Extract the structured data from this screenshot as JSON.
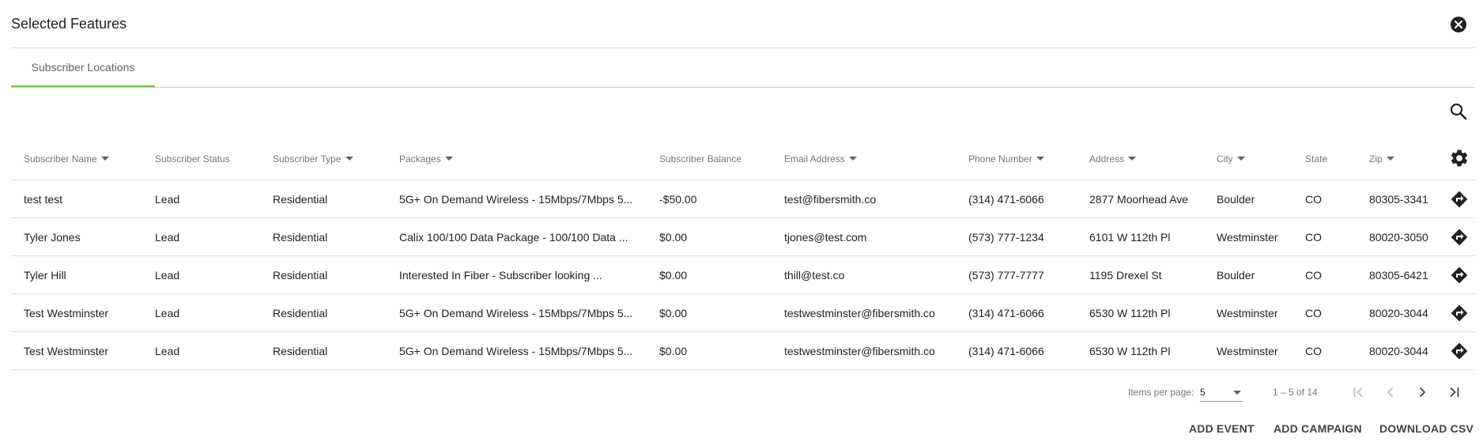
{
  "header": {
    "title": "Selected Features"
  },
  "tabs": [
    {
      "label": "Subscriber Locations"
    }
  ],
  "table": {
    "columns": [
      {
        "label": "Subscriber Name"
      },
      {
        "label": "Subscriber Status"
      },
      {
        "label": "Subscriber Type"
      },
      {
        "label": "Packages"
      },
      {
        "label": "Subscriber Balance"
      },
      {
        "label": "Email Address"
      },
      {
        "label": "Phone Number"
      },
      {
        "label": "Address"
      },
      {
        "label": "City"
      },
      {
        "label": "State"
      },
      {
        "label": "Zip"
      }
    ],
    "rows": [
      {
        "name": "test test",
        "status": "Lead",
        "type": "Residential",
        "packages": "5G+ On Demand Wireless - 15Mbps/7Mbps 5...",
        "balance": "-$50.00",
        "email": "test@fibersmith.co",
        "phone": "(314) 471-6066",
        "address": "2877 Moorhead Ave",
        "city": "Boulder",
        "state": "CO",
        "zip": "80305-3341"
      },
      {
        "name": "Tyler Jones",
        "status": "Lead",
        "type": "Residential",
        "packages": "Calix 100/100 Data Package - 100/100 Data ...",
        "balance": "$0.00",
        "email": "tjones@test.com",
        "phone": "(573) 777-1234",
        "address": "6101 W 112th Pl",
        "city": "Westminster",
        "state": "CO",
        "zip": "80020-3050"
      },
      {
        "name": "Tyler Hill",
        "status": "Lead",
        "type": "Residential",
        "packages": "Interested In Fiber - Subscriber looking ...",
        "balance": "$0.00",
        "email": "thill@test.co",
        "phone": "(573) 777-7777",
        "address": "1195 Drexel St",
        "city": "Boulder",
        "state": "CO",
        "zip": "80305-6421"
      },
      {
        "name": "Test Westminster",
        "status": "Lead",
        "type": "Residential",
        "packages": "5G+ On Demand Wireless - 15Mbps/7Mbps 5...",
        "balance": "$0.00",
        "email": "testwestminster@fibersmith.co",
        "phone": "(314) 471-6066",
        "address": "6530 W 112th Pl",
        "city": "Westminster",
        "state": "CO",
        "zip": "80020-3044"
      },
      {
        "name": "Test Westminster",
        "status": "Lead",
        "type": "Residential",
        "packages": "5G+ On Demand Wireless - 15Mbps/7Mbps 5...",
        "balance": "$0.00",
        "email": "testwestminster@fibersmith.co",
        "phone": "(314) 471-6066",
        "address": "6530 W 112th Pl",
        "city": "Westminster",
        "state": "CO",
        "zip": "80020-3044"
      }
    ]
  },
  "paginator": {
    "items_per_page_label": "Items per page:",
    "items_per_page": "5",
    "range": "1 – 5 of 14"
  },
  "actions": {
    "add_event": "ADD EVENT",
    "add_campaign": "ADD CAMPAIGN",
    "download_csv": "DOWNLOAD CSV"
  },
  "icons": {
    "close": "close-circle-icon",
    "search": "search-icon",
    "settings": "gear-icon",
    "directions": "directions-icon",
    "first": "first-page-icon",
    "prev": "chevron-left-icon",
    "next": "chevron-right-icon",
    "last": "last-page-icon"
  },
  "colors": {
    "tab_indicator": "#6fbf4b",
    "text": "#212121",
    "muted": "#757575"
  }
}
